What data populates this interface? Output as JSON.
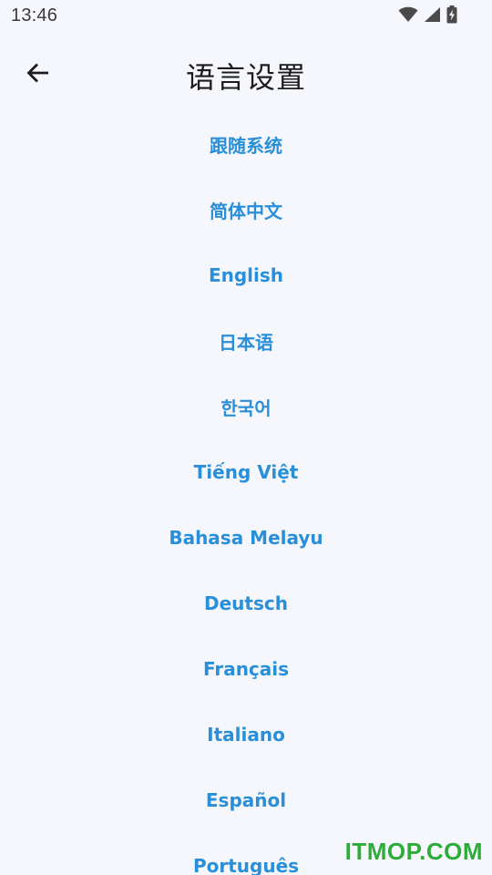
{
  "status_bar": {
    "time": "13:46",
    "icons": [
      "wifi-icon",
      "cellular-signal-icon",
      "battery-charging-icon"
    ]
  },
  "app_bar": {
    "back_icon": "arrow-left-icon",
    "title": "语言设置"
  },
  "languages": [
    {
      "id": "system",
      "label": "跟随系统"
    },
    {
      "id": "zh-hans",
      "label": "简体中文"
    },
    {
      "id": "en",
      "label": "English"
    },
    {
      "id": "ja",
      "label": "日本语"
    },
    {
      "id": "ko",
      "label": "한국어"
    },
    {
      "id": "vi",
      "label": "Tiếng Việt"
    },
    {
      "id": "ms",
      "label": "Bahasa Melayu"
    },
    {
      "id": "de",
      "label": "Deutsch"
    },
    {
      "id": "fr",
      "label": "Français"
    },
    {
      "id": "it",
      "label": "Italiano"
    },
    {
      "id": "es",
      "label": "Español"
    },
    {
      "id": "pt",
      "label": "Português"
    }
  ],
  "colors": {
    "background": "#f6f7fc",
    "accent": "#2a8fd9",
    "title": "#1c1c1c",
    "watermark": "#2eac3a"
  },
  "watermark": {
    "text": "ITMOP.COM"
  }
}
